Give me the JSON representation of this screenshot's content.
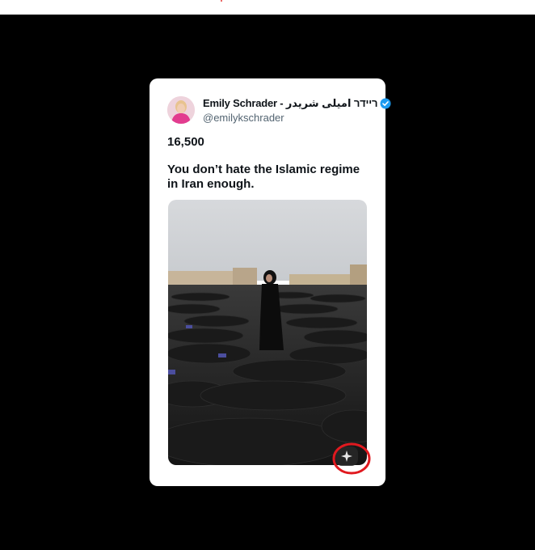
{
  "post": {
    "display_name": "Emily Schrader - ריידר امیلی شریدر",
    "handle": "@emilykschrader",
    "count": "16,500",
    "text": "You don’t hate the Islamic regime in Iran enough."
  },
  "icons": {
    "verified": "verified-badge-icon",
    "ai_sparkle": "sparkle-icon"
  },
  "colors": {
    "background": "#000000",
    "card": "#ffffff",
    "verified_blue": "#1d9bf0",
    "annotation_red": "#e0191f"
  }
}
